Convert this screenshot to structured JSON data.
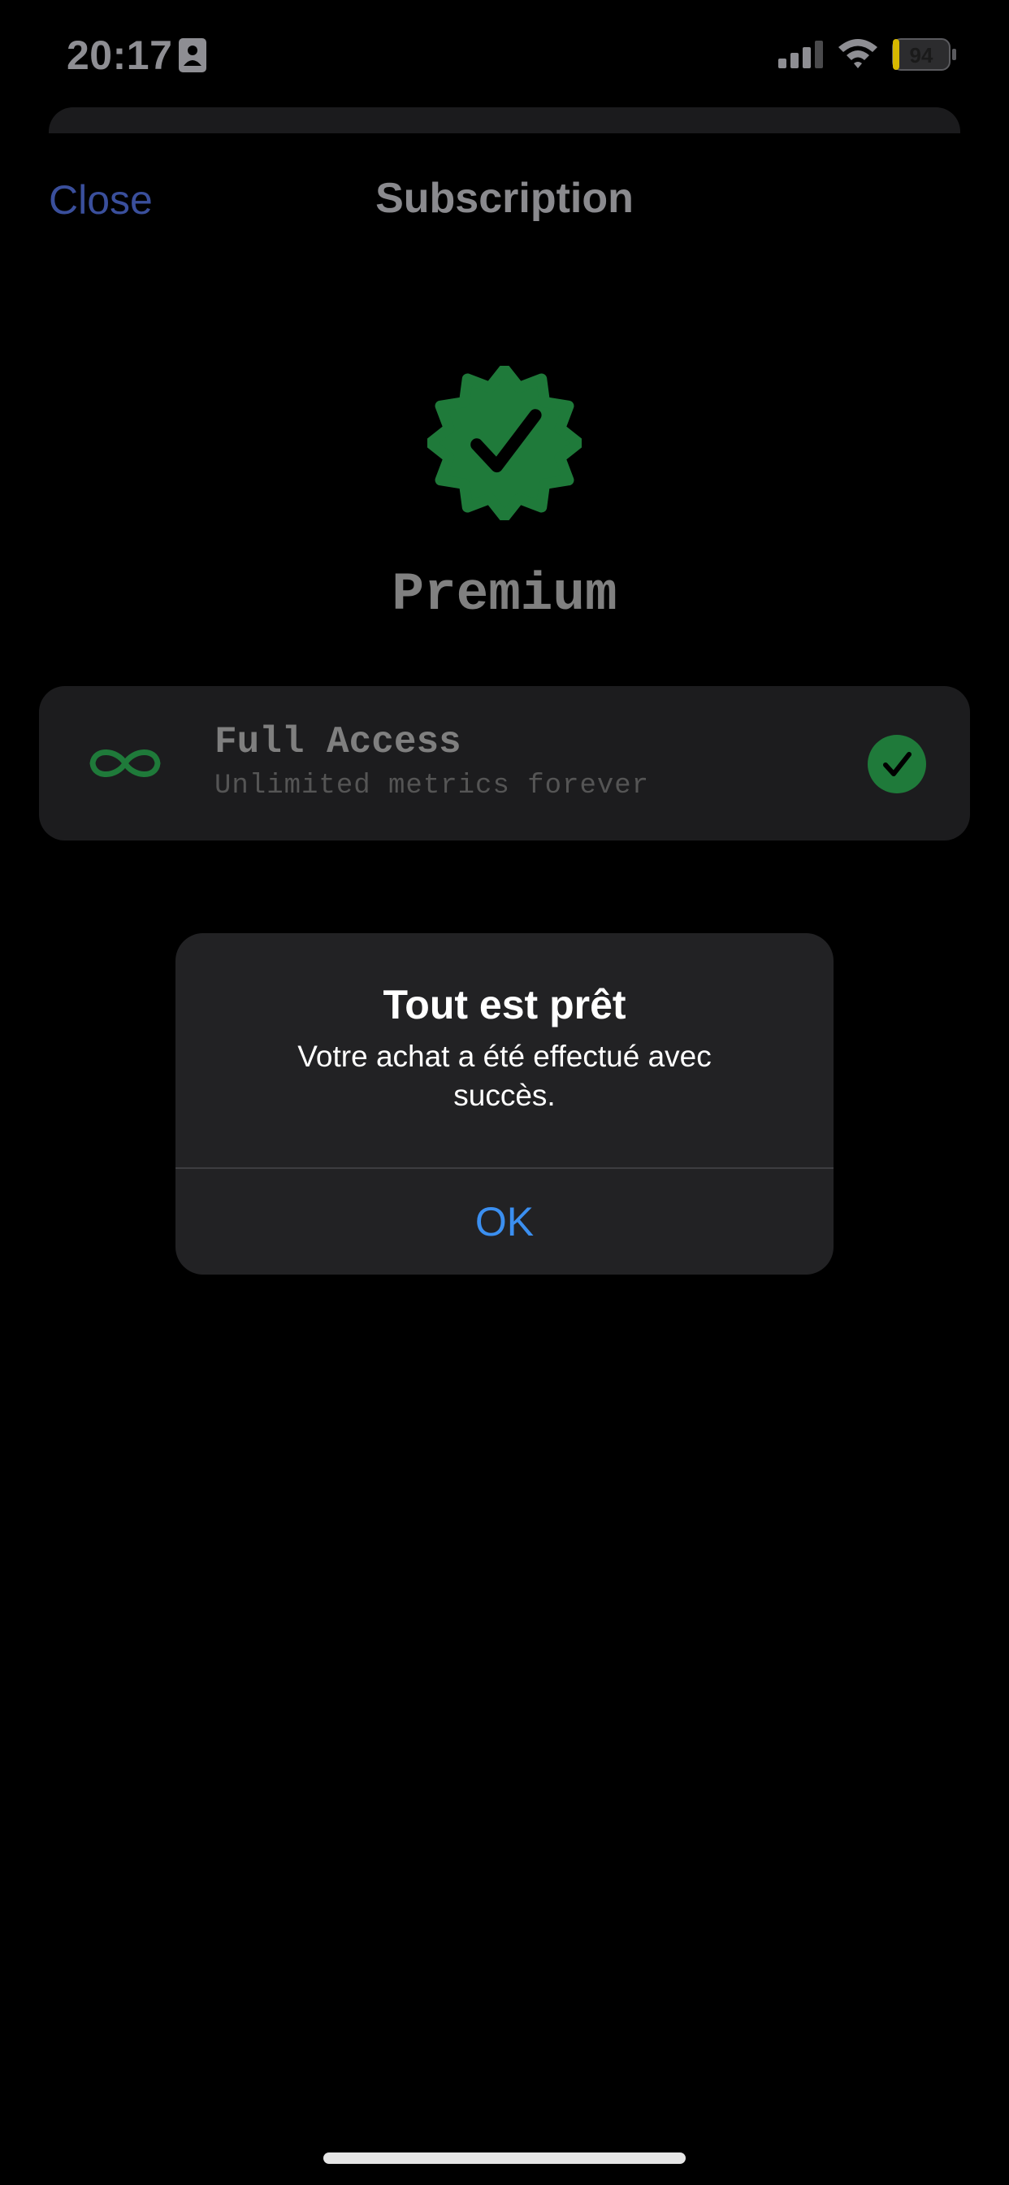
{
  "status_bar": {
    "time": "20:17",
    "battery": "94",
    "icons": [
      "contact-card-icon",
      "cellular-signal-icon",
      "wifi-icon",
      "battery-charging-icon"
    ]
  },
  "nav": {
    "close_label": "Close",
    "title": "Subscription"
  },
  "badge": {
    "icon": "verified-seal-check-icon",
    "title": "Premium"
  },
  "plan": {
    "name": "Full Access",
    "description": "Unlimited metrics forever",
    "icon": "infinity-icon",
    "selected": true
  },
  "alert": {
    "title": "Tout est prêt",
    "message": "Votre achat a été effectué avec succès.",
    "ok_label": "OK"
  },
  "colors": {
    "accent_green": "#1f7a3a",
    "link_blue": "#3b8ff0",
    "background": "#000000"
  }
}
